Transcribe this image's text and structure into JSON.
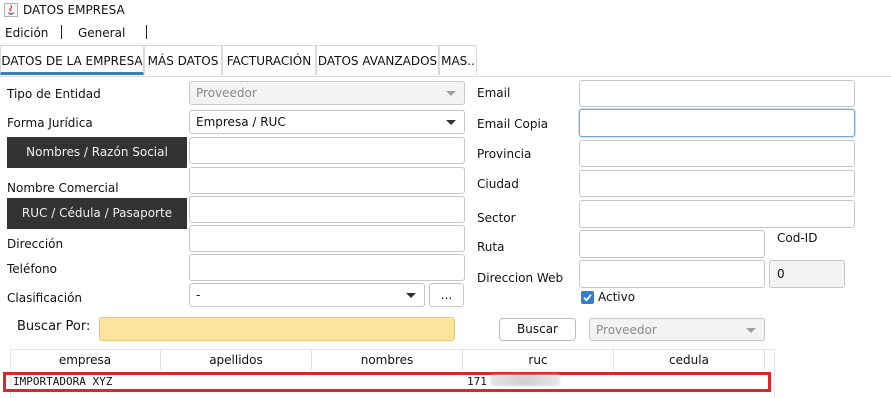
{
  "window": {
    "title": "DATOS EMPRESA"
  },
  "menu": [
    "Edición",
    "General"
  ],
  "tabs": [
    "DATOS DE LA EMPRESA",
    "MÁS DATOS",
    "FACTURACIÓN",
    "DATOS AVANZADOS",
    "MAS.."
  ],
  "left_form": {
    "tipo_entidad_label": "Tipo de Entidad",
    "tipo_entidad_value": "Proveedor",
    "forma_juridica_label": "Forma Jurídica",
    "forma_juridica_value": "Empresa / RUC",
    "nombres_button": "Nombres / Razón Social",
    "nombre_comercial_label": "Nombre Comercial",
    "ruc_button": "RUC / Cédula / Pasaporte",
    "direccion_label": "Dirección",
    "telefono_label": "Teléfono",
    "clasificacion_label": "Clasificación",
    "clasificacion_value": "-",
    "clasificacion_more": "..."
  },
  "right_form": {
    "email_label": "Email",
    "email_copia_label": "Email Copia",
    "provincia_label": "Provincia",
    "ciudad_label": "Ciudad",
    "sector_label": "Sector",
    "ruta_label": "Ruta",
    "cod_id_label": "Cod-ID",
    "direccion_web_label": "Direccion Web",
    "cod_id_value": "0",
    "activo_label": "Activo",
    "activo_checked": true
  },
  "search": {
    "label": "Buscar Por:",
    "value": "",
    "button": "Buscar",
    "filter_value": "Proveedor"
  },
  "grid": {
    "columns": [
      "empresa",
      "apellidos",
      "nombres",
      "ruc",
      "cedula"
    ],
    "rows": [
      {
        "empresa": "IMPORTADORA XYZ",
        "apellidos": "",
        "nombres": "",
        "ruc": "171",
        "cedula": ""
      }
    ]
  },
  "colors": {
    "accent": "#3c7fb1",
    "highlight": "#e0242a",
    "search_bg": "#fde39b",
    "dark_button": "#333333"
  }
}
